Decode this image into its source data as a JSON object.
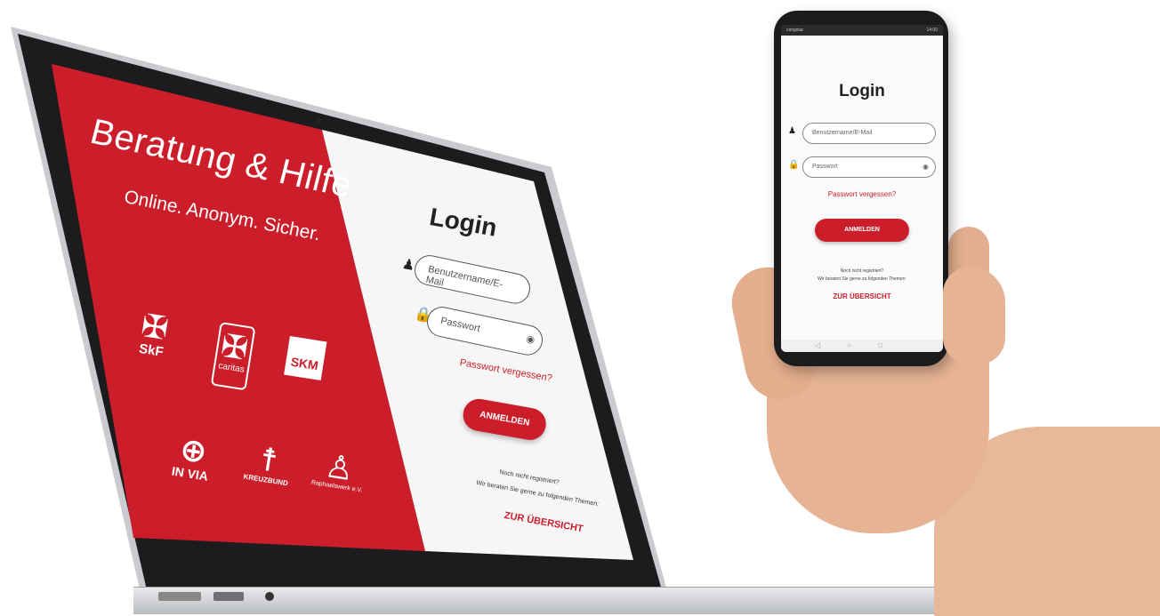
{
  "laptop": {
    "brand": {
      "title": "Beratung & Hilfe",
      "tagline": "Online. Anonym. Sicher.",
      "logos": [
        {
          "name": "SkF",
          "icon": "cross-rays-icon"
        },
        {
          "name": "caritas",
          "icon": "caritas-cross-icon"
        },
        {
          "name": "SKM",
          "icon": "skm-cross-icon"
        },
        {
          "name": "IN VIA",
          "icon": "globe-cross-icon"
        },
        {
          "name": "KREUZBUND",
          "icon": "people-group-icon"
        },
        {
          "name": "Raphaelswerk e.V.",
          "icon": "raphael-figure-icon"
        }
      ]
    },
    "login": {
      "title": "Login",
      "username_placeholder": "Benutzername/E-Mail",
      "password_placeholder": "Passwort",
      "forgot_password": "Passwort vergessen?",
      "submit": "ANMELDEN",
      "not_registered": "Noch nicht registriert?",
      "advice_text": "Wir beraten Sie gerne zu folgenden Themen:",
      "overview_link": "ZUR ÜBERSICHT"
    }
  },
  "phone": {
    "status_left": "congstar",
    "status_right": "14:00",
    "login": {
      "title": "Login",
      "username_placeholder": "Benutzername/E-Mail",
      "password_placeholder": "Passwort",
      "forgot_password": "Passwort vergessen?",
      "submit": "ANMELDEN",
      "not_registered": "Noch nicht registriert?",
      "advice_text": "Wir beraten Sie gerne zu folgenden Themen:",
      "overview_link": "ZUR ÜBERSICHT"
    },
    "nav_icons": [
      "back-icon",
      "home-icon",
      "recent-apps-icon"
    ]
  },
  "colors": {
    "brand_red": "#cc1e2a",
    "panel_light": "#f6f6f6",
    "text_dark": "#222222"
  }
}
